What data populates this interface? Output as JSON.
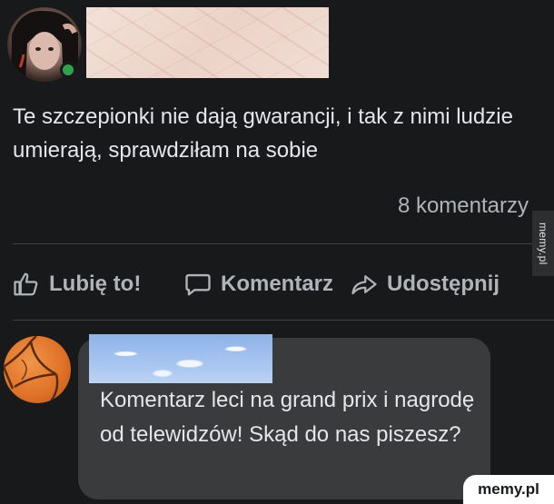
{
  "post": {
    "text": "Te szczepionki nie dają gwarancji, i tak z nimi ludzie umierają, sprawdziłam na sobie",
    "comment_count": "8 komentarzy"
  },
  "actions": {
    "like_label": "Lubię to!",
    "comment_label": "Komentarz",
    "share_label": "Udostępnij"
  },
  "comment": {
    "text": "Komentarz leci na grand prix i nagrodę od telewidzów! Skąd do nas piszesz?"
  },
  "watermarks": {
    "side": "memy.pl",
    "corner": "memy.pl"
  },
  "icons": {
    "like": "thumbs-up-icon",
    "comment": "speech-bubble-icon",
    "share": "share-arrow-icon"
  },
  "colors": {
    "background": "#18191a",
    "bubble": "#3a3b3c",
    "text": "#e4e6eb",
    "muted": "#b0b3b8",
    "online": "#31a24c"
  }
}
